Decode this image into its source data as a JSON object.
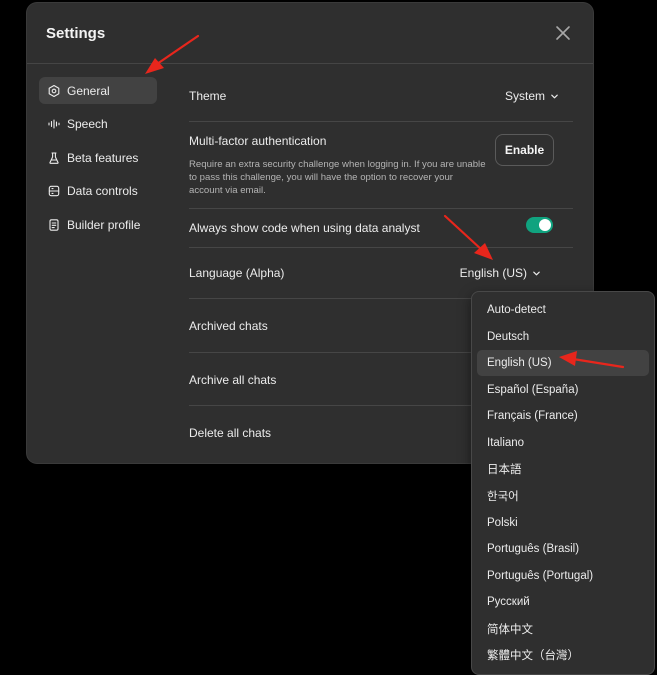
{
  "dialog": {
    "title": "Settings"
  },
  "sidebar": {
    "items": [
      {
        "label": "General",
        "icon": "gear-icon"
      },
      {
        "label": "Speech",
        "icon": "waveform-icon"
      },
      {
        "label": "Beta features",
        "icon": "flask-icon"
      },
      {
        "label": "Data controls",
        "icon": "database-icon"
      },
      {
        "label": "Builder profile",
        "icon": "id-card-icon"
      }
    ]
  },
  "general": {
    "theme": {
      "label": "Theme",
      "value": "System"
    },
    "mfa": {
      "label": "Multi-factor authentication",
      "description": "Require an extra security challenge when logging in. If you are unable to pass this challenge, you will have the option to recover your account via email.",
      "button": "Enable"
    },
    "code": {
      "label": "Always show code when using data analyst",
      "enabled": true
    },
    "language": {
      "label": "Language (Alpha)",
      "value": "English (US)"
    },
    "archived": {
      "label": "Archived chats"
    },
    "archive_all": {
      "label": "Archive all chats"
    },
    "delete_all": {
      "label": "Delete all chats"
    }
  },
  "language_menu": {
    "selected": "English (US)",
    "options": [
      "Auto-detect",
      "Deutsch",
      "English (US)",
      "Español (España)",
      "Français (France)",
      "Italiano",
      "日本語",
      "한국어",
      "Polski",
      "Português (Brasil)",
      "Português (Portugal)",
      "Русский",
      "简体中文",
      "繁體中文（台灣）"
    ]
  },
  "colors": {
    "accent_toggle": "#10a37f",
    "annotation_arrow": "#e8261c"
  }
}
